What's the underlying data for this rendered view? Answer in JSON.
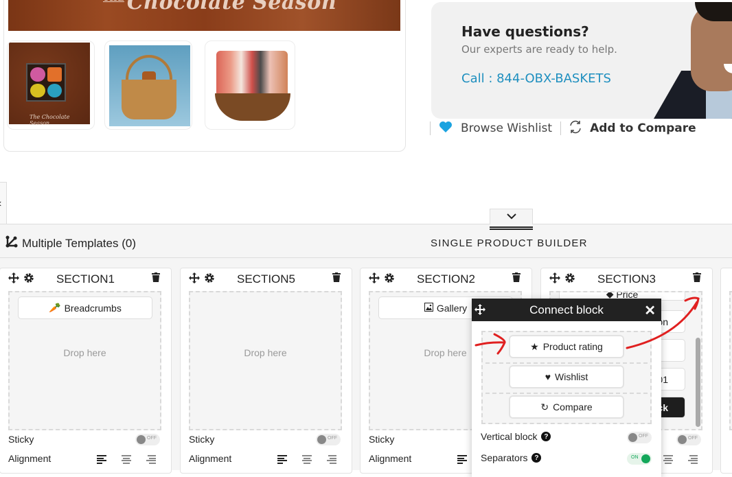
{
  "product": {
    "banner_text": "Chocolate Season",
    "banner_prefix": "THE",
    "thumbnails": [
      {
        "name": "chocolate-box-thumbnail",
        "caption": "The Chocolate Season"
      },
      {
        "name": "gift-basket-blue-thumbnail",
        "caption": ""
      },
      {
        "name": "gourmet-basket-thumbnail",
        "caption": ""
      }
    ]
  },
  "help": {
    "title": "Have questions?",
    "subtitle": "Our experts are ready to help.",
    "call": "Call : 844-OBX-BASKETS"
  },
  "actions": {
    "wishlist_label": "Browse Wishlist",
    "compare_label": "Add to Compare",
    "wishlist_color": "#1ba3e0"
  },
  "builder": {
    "multiple_templates": "Multiple Templates (0)",
    "title": "SINGLE PRODUCT BUILDER",
    "sections": [
      {
        "title": "SECTION1",
        "block": "Breadcrumbs",
        "drop_text": "Drop here",
        "sticky_label": "Sticky",
        "sticky": "OFF",
        "alignment_label": "Alignment",
        "alignment": "left"
      },
      {
        "title": "SECTION5",
        "block": "",
        "drop_text": "Drop here",
        "sticky_label": "Sticky",
        "sticky": "OFF",
        "alignment_label": "Alignment",
        "alignment": "left"
      },
      {
        "title": "SECTION2",
        "block": "Gallery",
        "drop_text": "Drop here",
        "sticky_label": "Sticky",
        "sticky": "OFF",
        "alignment_label": "Alignment",
        "alignment": "left"
      },
      {
        "title": "SECTION3",
        "blocks_partial": [
          "Price",
          "on",
          "",
          "01",
          "ck"
        ],
        "sticky": "OFF"
      }
    ]
  },
  "modal": {
    "title": "Connect block",
    "blocks": [
      "Product rating",
      "Wishlist",
      "Compare"
    ],
    "vertical_block_label": "Vertical block",
    "vertical_block": "OFF",
    "separators_label": "Separators",
    "separators": "ON",
    "on_color": "#13a75a"
  },
  "toggle_off_text": "OFF",
  "toggle_on_text": "ON",
  "annotation_color": "#e02020"
}
